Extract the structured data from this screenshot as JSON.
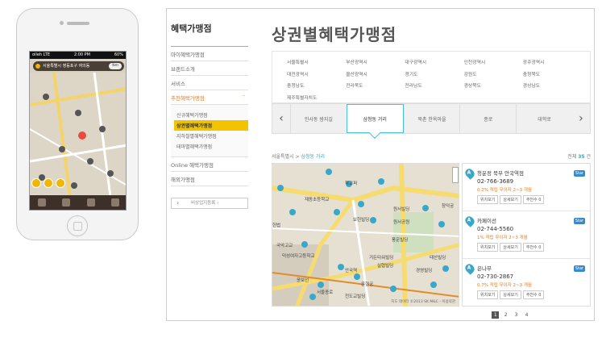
{
  "phone": {
    "status_left": "olleh LTE",
    "status_time": "2:00 PM",
    "status_right": "60%",
    "search_text": "서울특별시 영등포구 여의동",
    "search_button": "Nm"
  },
  "sidebar": {
    "title": "혜택가맹점",
    "items": [
      {
        "label": "마이혜택가맹점"
      },
      {
        "label": "브랜드소개"
      },
      {
        "label": "서비스"
      },
      {
        "label": "추천혜택가맹점"
      }
    ],
    "sub_items": [
      {
        "label": "신규혜택가맹점"
      },
      {
        "label": "상권별혜택가맹점"
      },
      {
        "label": "지하철별혜택가맹점"
      },
      {
        "label": "테마별혜택가맹점"
      }
    ],
    "items_after": [
      {
        "label": "Online 혜택가맹점"
      },
      {
        "label": "해외가맹점"
      }
    ],
    "box_label": "비상업지등록 ›"
  },
  "main": {
    "title": "상권별혜택가맹점",
    "regions": [
      "서울특별시",
      "부산광역시",
      "대구광역시",
      "인천광역시",
      "광주광역시",
      "대전광역시",
      "울산광역시",
      "경기도",
      "강원도",
      "충청북도",
      "충청남도",
      "전라북도",
      "전라남도",
      "경상북도",
      "경상남도",
      "제주특별자치도"
    ],
    "tabs": [
      "인사동 쌈지길",
      "삼청동 거리",
      "북촌 한옥마을",
      "종로",
      "대학로"
    ],
    "active_tab": "삼청동 거리",
    "breadcrumb_region": "서울특별시",
    "breadcrumb_sep": " > ",
    "breadcrumb_area": "삼청동 거리",
    "total_label": "전체",
    "total_count": "35",
    "total_unit": "건",
    "stores": [
      {
        "marker": "A",
        "name": "청운정 북부 안국역점",
        "phone": "02-766-3689",
        "benefit": "0.2% 적립 무이자 2~3 개월",
        "badge": "Star",
        "buttons": [
          "위치보기",
          "상세보기",
          "추천수 0"
        ]
      },
      {
        "marker": "A",
        "name": "카페이선",
        "phone": "02-744-5560",
        "benefit": "1% 적립 무이자 2~3 개월",
        "badge": "Star",
        "buttons": [
          "위치보기",
          "상세보기",
          "추천수 0"
        ]
      },
      {
        "marker": "A",
        "name": "은나무",
        "phone": "02-730-2867",
        "benefit": "0.7% 적립 무이자 2~3 개월",
        "badge": "Star",
        "buttons": [
          "위치보기",
          "상세보기",
          "추천수 0"
        ]
      }
    ],
    "map_labels": [
      "학교퍼",
      "재동초등학교",
      "원서빌딩",
      "창덕궁",
      "원서공원",
      "보헌빌딩",
      "헌법",
      "풍문빌딩",
      "거든타워빌딩",
      "국악고교",
      "덕성여자고등학교",
      "안국역",
      "윤보선",
      "실협빌딩",
      "경영빌딩",
      "태산빌딩",
      "서울종로",
      "천도교빌딩",
      "운현궁"
    ],
    "map_copyright": "지도 데이터 ©2013 SK M&C - 이용약관",
    "pages": [
      "1",
      "2",
      "3",
      "4"
    ]
  },
  "colors": {
    "accent": "#3aa7c8",
    "highlight": "#f2c400",
    "orange": "#e37c1c"
  }
}
